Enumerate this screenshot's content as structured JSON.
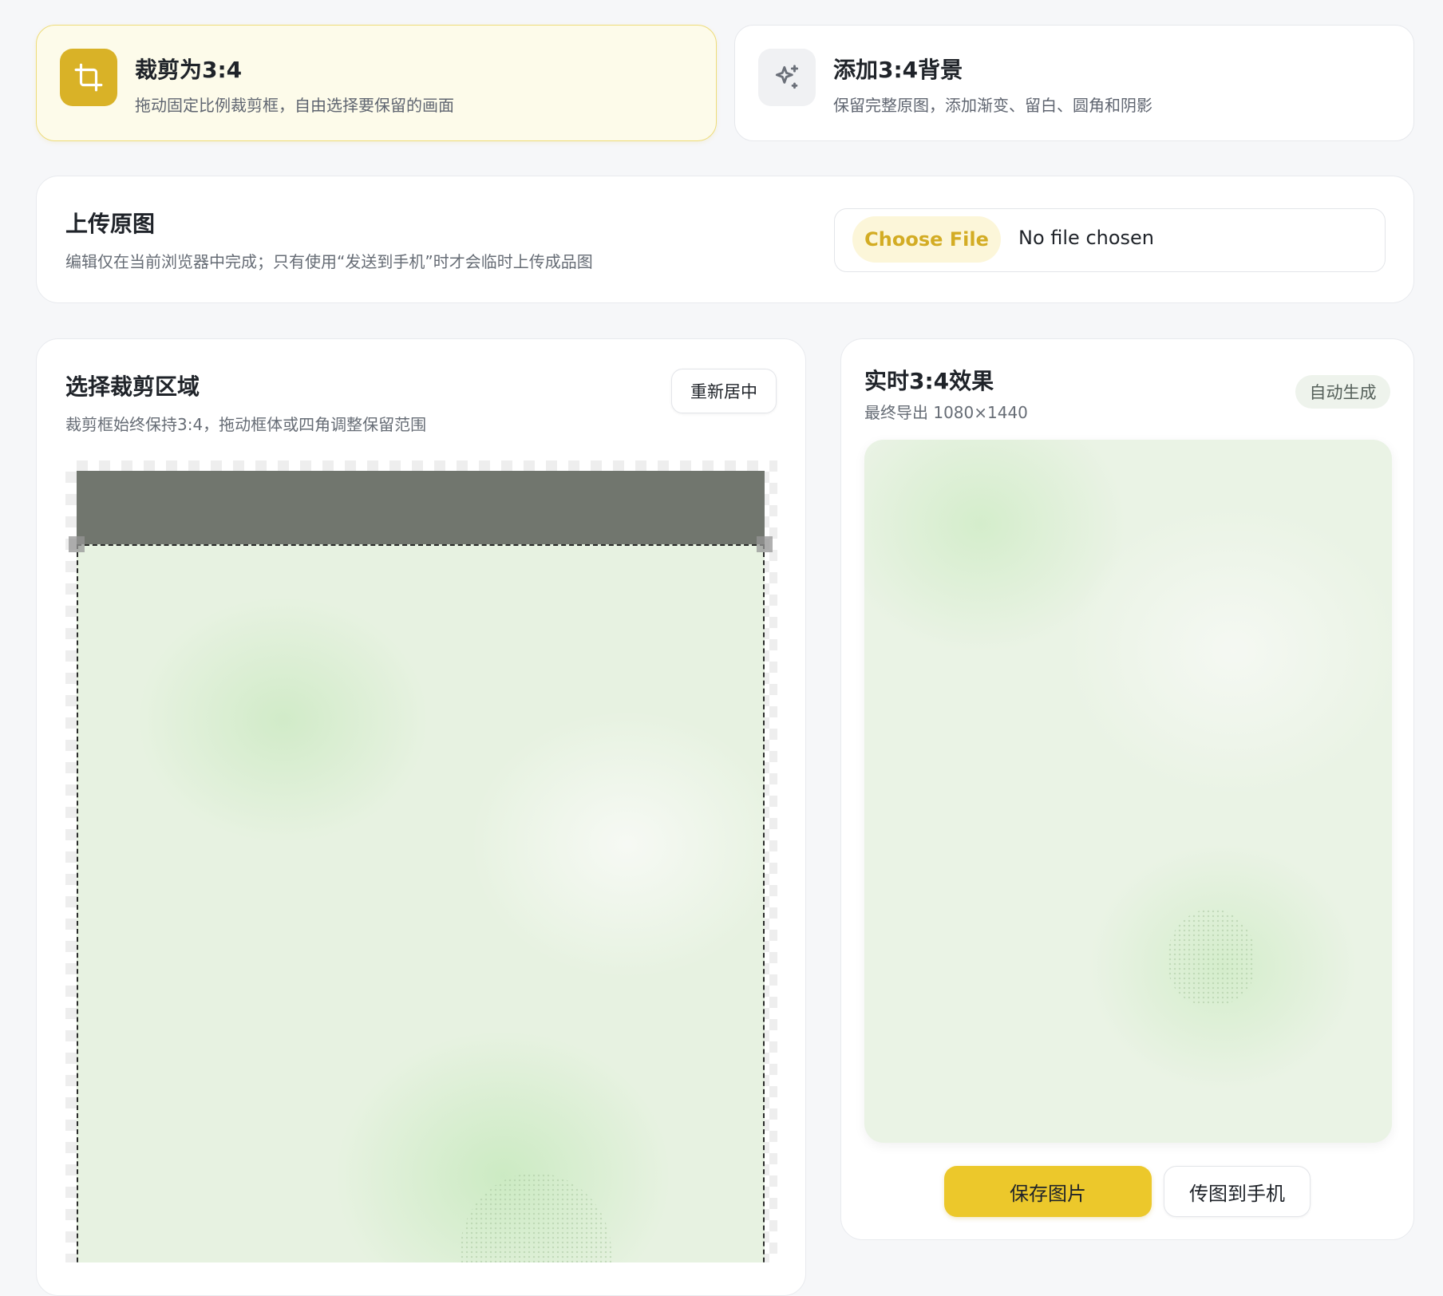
{
  "modes": [
    {
      "title": "裁剪为3:4",
      "description": "拖动固定比例裁剪框，自由选择要保留的画面",
      "icon": "crop-icon",
      "active": true
    },
    {
      "title": "添加3:4背景",
      "description": "保留完整原图，添加渐变、留白、圆角和阴影",
      "icon": "sparkles-icon",
      "active": false
    }
  ],
  "upload": {
    "title": "上传原图",
    "description": "编辑仅在当前浏览器中完成；只有使用“发送到手机”时才会临时上传成品图",
    "choose_label": "Choose File",
    "status": "No file chosen"
  },
  "crop": {
    "title": "选择裁剪区域",
    "description": "裁剪框始终保持3:4，拖动框体或四角调整保留范围",
    "recenter_label": "重新居中"
  },
  "preview": {
    "title": "实时3:4效果",
    "subtitle": "最终导出 1080×1440",
    "badge": "自动生成",
    "save_label": "保存图片",
    "send_label": "传图到手机"
  },
  "colors": {
    "accent": "#ecc82b",
    "accent_dark": "#d9b227",
    "active_card_bg": "#fdfbea"
  }
}
